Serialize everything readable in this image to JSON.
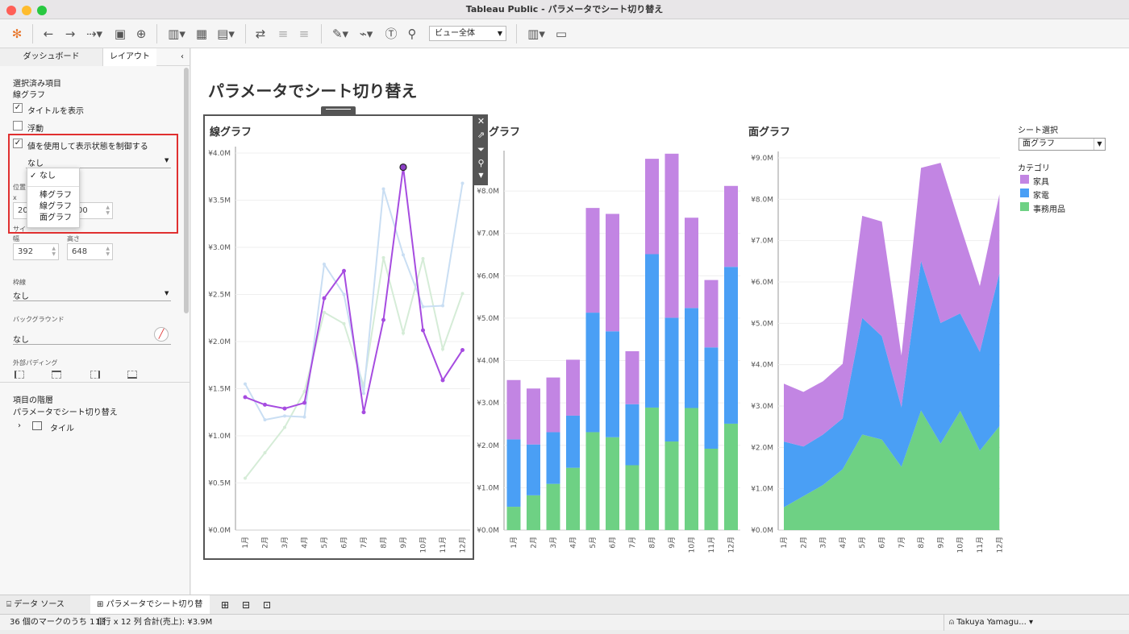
{
  "window": {
    "title": "Tableau Public - パラメータでシート切り替え"
  },
  "toolbar": {
    "view_select": "ビュー全体"
  },
  "left_panel": {
    "tabs": [
      "ダッシュボード",
      "レイアウト"
    ],
    "selected_heading": "選択済み項目",
    "selected_name": "線グラフ",
    "show_title_label": "タイトルを表示",
    "floating_label": "浮動",
    "control_visibility_label": "値を使用して表示状態を制御する",
    "control_visibility_value": "なし",
    "dropdown_options": [
      "なし",
      "棒グラフ",
      "線グラフ",
      "面グラフ"
    ],
    "position_label": "位置",
    "x_label": "x",
    "x_value": "20",
    "y_value": "00",
    "size_label": "サイ",
    "width_label": "幅",
    "height_label": "高さ",
    "width_value": "392",
    "height_value": "648",
    "border_label": "枠線",
    "border_value": "なし",
    "background_label": "バックグラウンド",
    "background_value": "なし",
    "padding_label": "外部パディング",
    "hierarchy_label": "項目の階層",
    "hierarchy_root": "パラメータでシート切り替え",
    "hierarchy_child": "タイル"
  },
  "dashboard": {
    "title": "パラメータでシート切り替え",
    "sheet_titles": [
      "線グラフ",
      "棒グラフ",
      "面グラフ"
    ],
    "bar_title_visible": "グラフ",
    "parameter_label": "シート選択",
    "parameter_value": "面グラフ",
    "legend_title": "カテゴリ",
    "legend": [
      {
        "name": "家具",
        "color": "#c285e3"
      },
      {
        "name": "家電",
        "color": "#4a9ff5"
      },
      {
        "name": "事務用品",
        "color": "#6ed184"
      }
    ]
  },
  "chart_data": [
    {
      "type": "line",
      "title": "線グラフ",
      "categories": [
        "1月",
        "2月",
        "3月",
        "4月",
        "5月",
        "6月",
        "7月",
        "8月",
        "9月",
        "10月",
        "11月",
        "12月"
      ],
      "y_ticks": [
        "¥0.0M",
        "¥0.5M",
        "¥1.0M",
        "¥1.5M",
        "¥2.0M",
        "¥2.5M",
        "¥3.0M",
        "¥3.5M",
        "¥4.0M"
      ],
      "ylim": [
        0,
        4.0
      ],
      "series": [
        {
          "name": "家具",
          "color": "#a64ce0",
          "values": [
            1.41,
            1.33,
            1.29,
            1.35,
            2.46,
            2.75,
            1.25,
            2.23,
            3.85,
            2.12,
            1.59,
            1.91
          ]
        },
        {
          "name": "家電",
          "color": "#c9def3",
          "values": [
            1.55,
            1.17,
            1.21,
            1.2,
            2.82,
            2.5,
            1.45,
            3.62,
            2.92,
            2.37,
            2.38,
            3.68
          ]
        },
        {
          "name": "事務用品",
          "color": "#d5ecd7",
          "values": [
            0.55,
            0.82,
            1.09,
            1.47,
            2.31,
            2.19,
            1.53,
            2.89,
            2.09,
            2.88,
            1.92,
            2.51
          ]
        }
      ]
    },
    {
      "type": "bar",
      "title": "棒グラフ",
      "categories": [
        "1月",
        "2月",
        "3月",
        "4月",
        "5月",
        "6月",
        "7月",
        "8月",
        "9月",
        "10月",
        "11月",
        "12月"
      ],
      "y_ticks": [
        "¥0.0M",
        "¥1.0M",
        "¥2.0M",
        "¥3.0M",
        "¥4.0M",
        "¥5.0M",
        "¥6.0M",
        "¥7.0M",
        "¥8.0M"
      ],
      "ylim": [
        0,
        8.8
      ],
      "stacked": true,
      "series": [
        {
          "name": "事務用品",
          "values": [
            0.55,
            0.82,
            1.09,
            1.47,
            2.31,
            2.19,
            1.53,
            2.89,
            2.09,
            2.88,
            1.92,
            2.51
          ]
        },
        {
          "name": "家電",
          "values": [
            1.59,
            1.2,
            1.22,
            1.23,
            2.82,
            2.5,
            1.44,
            3.62,
            2.92,
            2.36,
            2.39,
            3.7
          ]
        },
        {
          "name": "家具",
          "values": [
            1.4,
            1.32,
            1.29,
            1.32,
            2.47,
            2.77,
            1.25,
            2.25,
            3.87,
            2.13,
            1.59,
            1.91
          ]
        }
      ]
    },
    {
      "type": "area",
      "title": "面グラフ",
      "categories": [
        "1月",
        "2月",
        "3月",
        "4月",
        "5月",
        "6月",
        "7月",
        "8月",
        "9月",
        "10月",
        "11月",
        "12月"
      ],
      "y_ticks": [
        "¥0.0M",
        "¥1.0M",
        "¥2.0M",
        "¥3.0M",
        "¥4.0M",
        "¥5.0M",
        "¥6.0M",
        "¥7.0M",
        "¥8.0M",
        "¥9.0M"
      ],
      "ylim": [
        0,
        9.0
      ],
      "stacked": true,
      "series": [
        {
          "name": "事務用品",
          "values": [
            0.55,
            0.82,
            1.09,
            1.47,
            2.31,
            2.19,
            1.53,
            2.89,
            2.09,
            2.88,
            1.92,
            2.51
          ]
        },
        {
          "name": "家電",
          "values": [
            1.59,
            1.2,
            1.22,
            1.23,
            2.82,
            2.5,
            1.44,
            3.62,
            2.92,
            2.36,
            2.39,
            3.7
          ]
        },
        {
          "name": "家具",
          "values": [
            1.4,
            1.32,
            1.29,
            1.32,
            2.47,
            2.77,
            1.25,
            2.25,
            3.87,
            2.13,
            1.59,
            1.91
          ]
        }
      ]
    }
  ],
  "bottom_tabs": {
    "data_source": "データ ソース",
    "sheet": "パラメータでシート切り替え"
  },
  "status": {
    "marks": "36 個のマークのうち 1 個",
    "rows_cols": "1 行 x 12 列",
    "sum": "合計(売上): ¥3.9M",
    "user": "Takuya Yamagu..."
  }
}
